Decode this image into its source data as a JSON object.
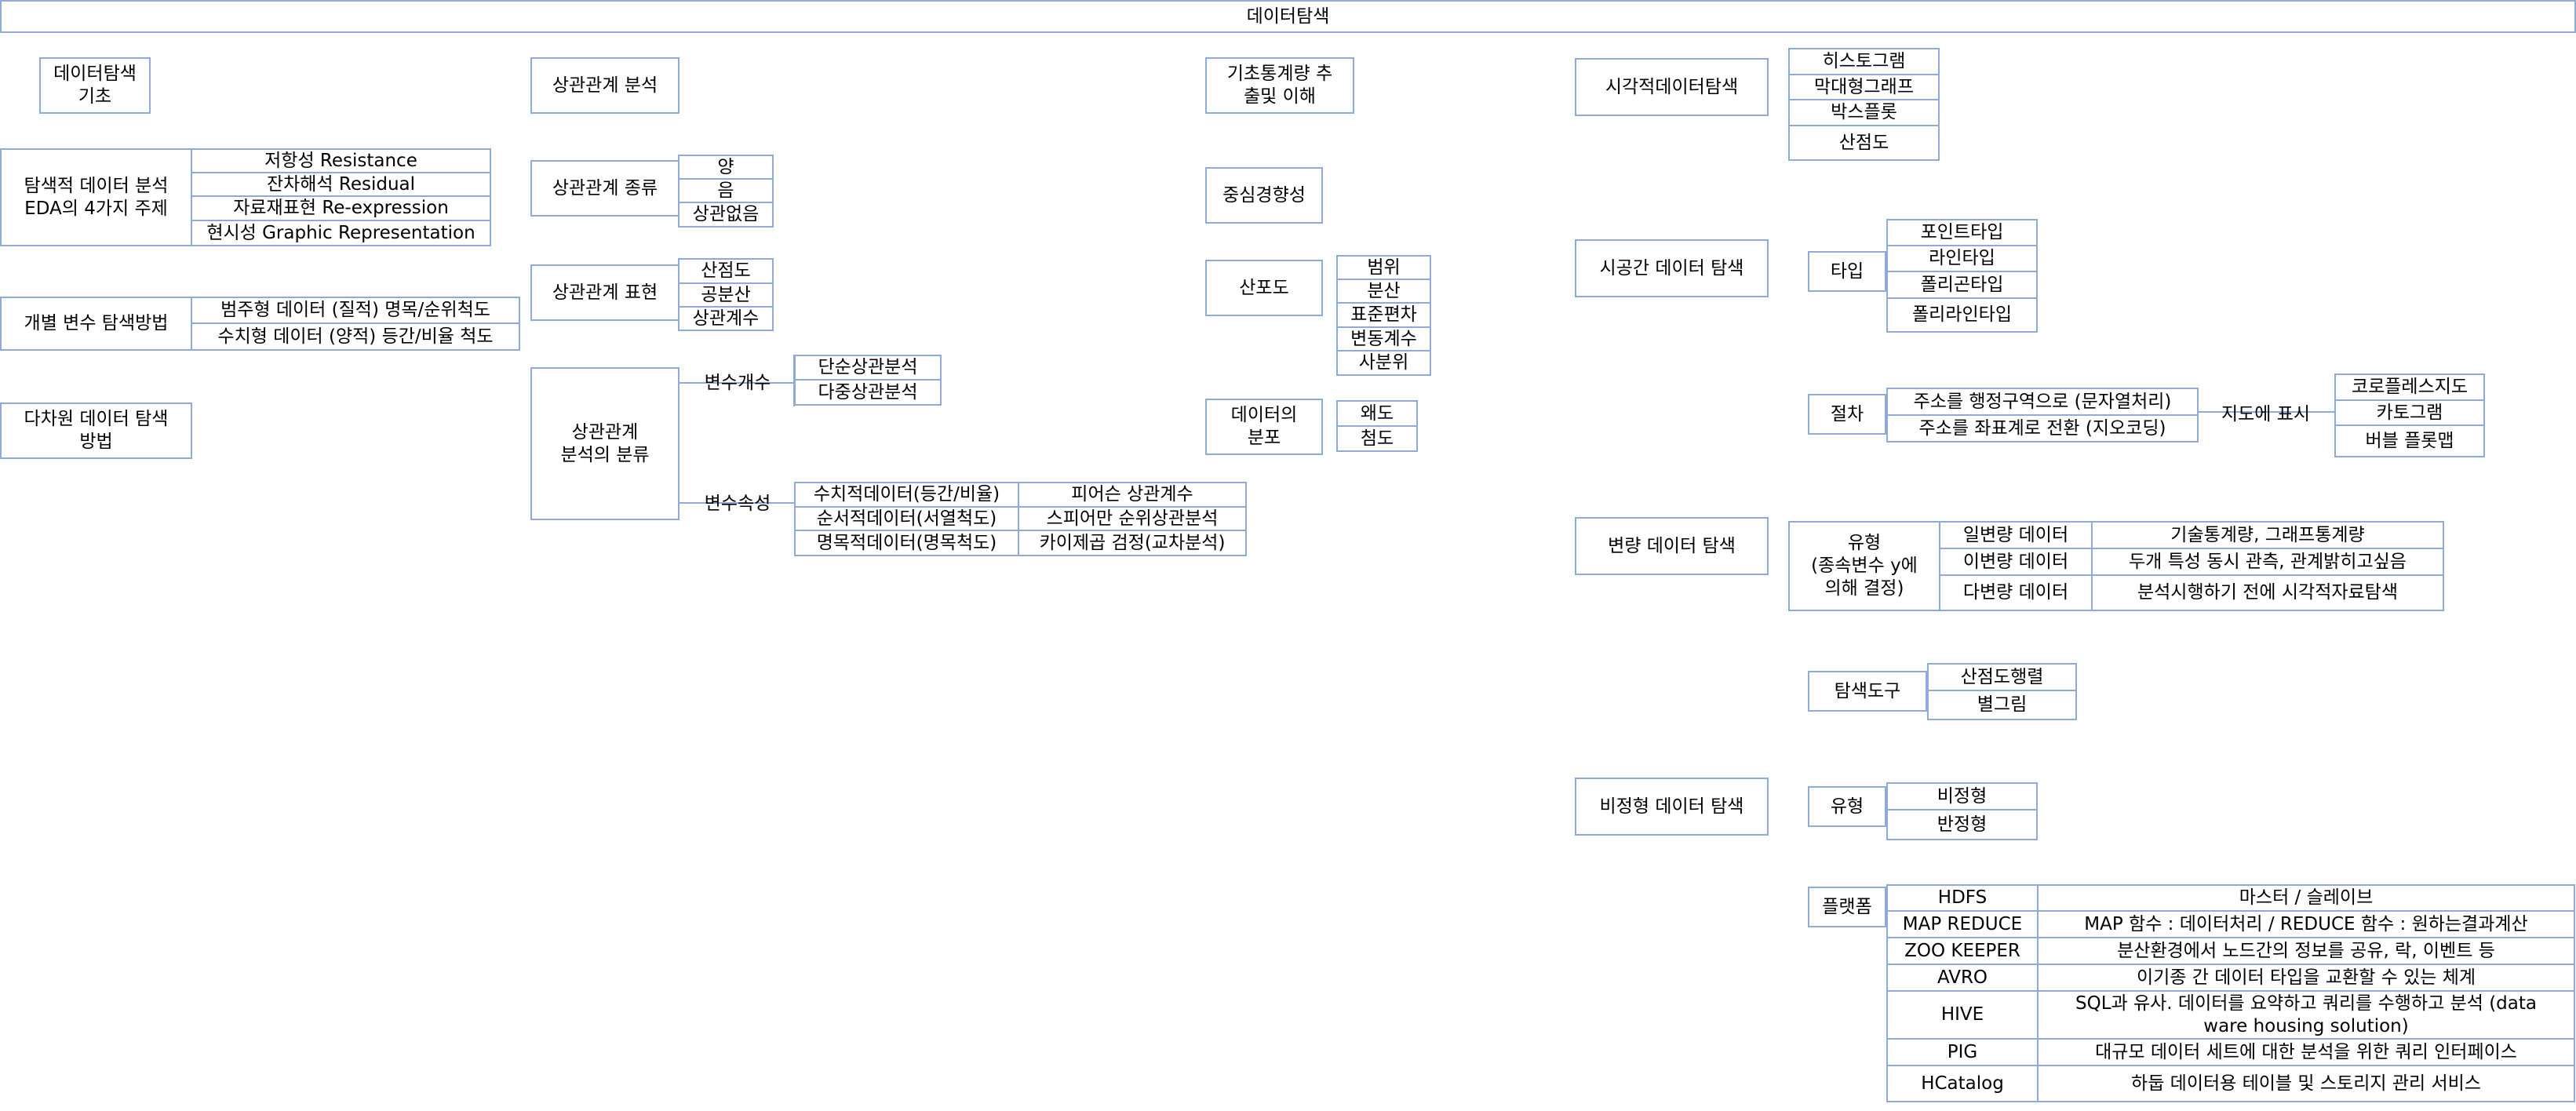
{
  "title": "데이터탐색",
  "basics": {
    "header": "데이터탐색\n기초",
    "eda": {
      "label": "탐색적 데이터 분석\nEDA의 4가지 주제",
      "items": [
        "저항성 Resistance",
        "잔차해석 Residual",
        "자료재표현 Re-expression",
        "현시성 Graphic Representation"
      ]
    },
    "individual": {
      "label": "개별 변수 탐색방법",
      "items": [
        "범주형 데이터 (질적) 명목/순위척도",
        "수치형 데이터 (양적) 등간/비율 척도"
      ]
    },
    "multivariate": "다차원 데이터 탐색\n방법"
  },
  "correlation": {
    "header": "상관관계 분석",
    "kinds": {
      "label": "상관관계 종류",
      "items": [
        "양",
        "음",
        "상관없음"
      ]
    },
    "expression": {
      "label": "상관관계 표현",
      "items": [
        "산점도",
        "공분산",
        "상관계수"
      ]
    },
    "classification": {
      "label": "상관관계\n분석의 분류",
      "var_count": {
        "label": "변수개수",
        "items": [
          "단순상관분석",
          "다중상관분석"
        ]
      },
      "var_attr": {
        "label": "변수속성",
        "rows": [
          {
            "data": "수치적데이터(등간/비율)",
            "method": "피어슨 상관계수"
          },
          {
            "data": "순서적데이터(서열척도)",
            "method": "스피어만 순위상관분석"
          },
          {
            "data": "명목적데이터(명목척도)",
            "method": "카이제곱 검정(교차분석)"
          }
        ]
      }
    }
  },
  "stats": {
    "header": "기초통계량 추\n출및 이해",
    "central": "중심경향성",
    "dispersion": {
      "label": "산포도",
      "items": [
        "범위",
        "분산",
        "표준편차",
        "변동계수",
        "사분위"
      ]
    },
    "distribution": {
      "label": "데이터의\n분포",
      "items": [
        "왜도",
        "첨도"
      ]
    }
  },
  "visual": {
    "label": "시각적데이터탐색",
    "items": [
      "히스토그램",
      "막대형그래프",
      "박스플롯",
      "산점도"
    ]
  },
  "spatial": {
    "label": "시공간 데이터 탐색",
    "type": {
      "label": "타입",
      "items": [
        "포인트타입",
        "라인타입",
        "폴리곤타입",
        "폴리라인타입"
      ]
    },
    "procedure": {
      "label": "절차",
      "steps": [
        "주소를 행정구역으로 (문자열처리)",
        "주소를 좌표계로 전환 (지오코딩)"
      ],
      "display": "지도에 표시",
      "maps": [
        "코로플레스지도",
        "카토그램",
        "버블 플롯맵"
      ]
    }
  },
  "variable": {
    "label": "변량 데이터 탐색",
    "type": {
      "label": "유형\n(종속변수  y에\n의해 결정)",
      "rows": [
        {
          "name": "일변량 데이터",
          "desc": "기술통계량, 그래프통계량"
        },
        {
          "name": "이변량 데이터",
          "desc": "두개 특성 동시 관측, 관계밝히고싶음"
        },
        {
          "name": "다변량 데이터",
          "desc": "분석시행하기 전에 시각적자료탐색"
        }
      ]
    },
    "tool": {
      "label": "탐색도구",
      "items": [
        "산점도행렬",
        "별그림"
      ]
    }
  },
  "unstructured": {
    "label": "비정형 데이터 탐색",
    "type": {
      "label": "유형",
      "items": [
        "비정형",
        "반정형"
      ]
    },
    "platform": {
      "label": "플랫폼",
      "rows": [
        {
          "name": "HDFS",
          "desc": "마스터 / 슬레이브"
        },
        {
          "name": "MAP REDUCE",
          "desc": "MAP 함수 : 데이터처리 / REDUCE 함수 : 원하는결과계산"
        },
        {
          "name": "ZOO KEEPER",
          "desc": "분산환경에서 노드간의 정보를 공유, 락, 이벤트 등"
        },
        {
          "name": "AVRO",
          "desc": "이기종 간 데이터 타입을 교환할 수 있는 체계"
        },
        {
          "name": "HIVE",
          "desc": "SQL과 유사. 데이터를 요약하고 쿼리를 수행하고 분석 (data\nware housing solution)"
        },
        {
          "name": "PIG",
          "desc": "대규모 데이터 세트에 대한 분석을 위한 쿼리 인터페이스"
        },
        {
          "name": "HCatalog",
          "desc": "하둡 데이터용 테이블 및 스토리지 관리 서비스"
        }
      ]
    }
  }
}
